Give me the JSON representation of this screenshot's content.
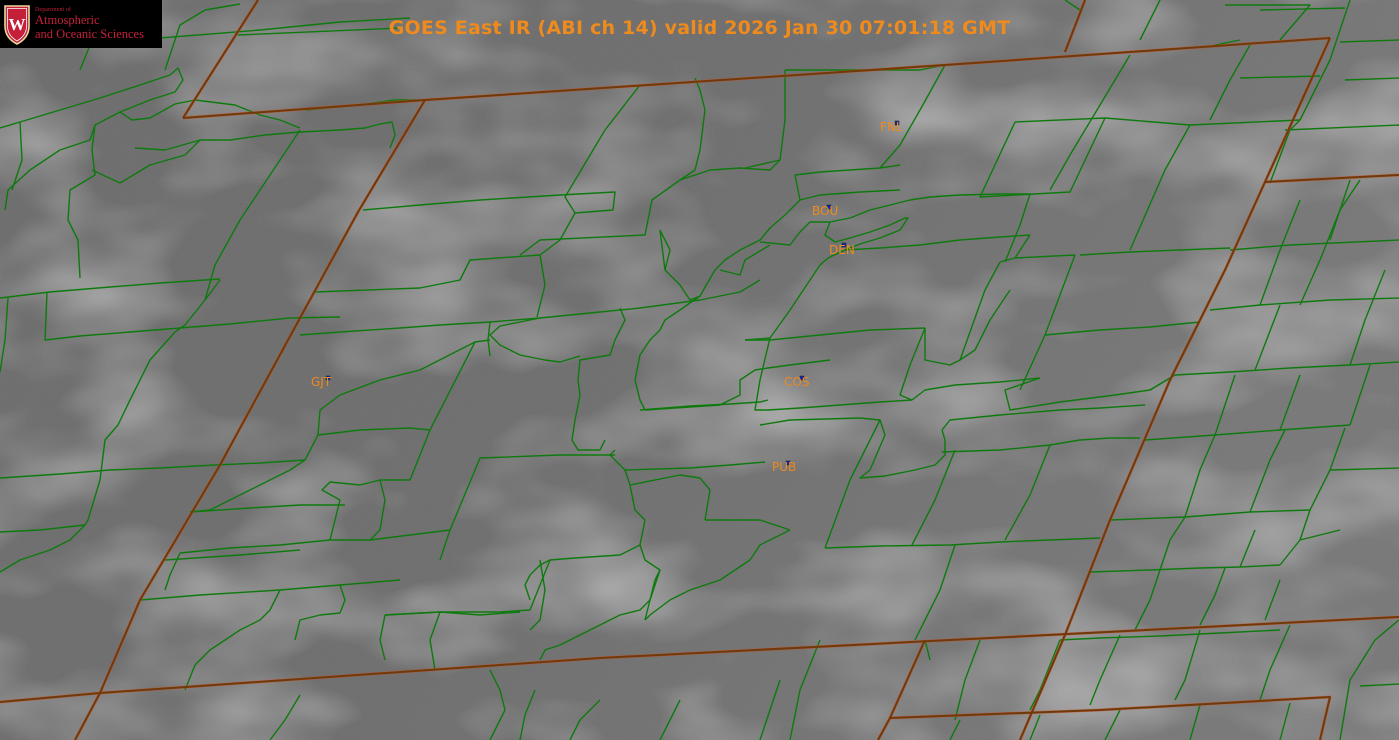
{
  "title": "GOES East IR (ABI ch 14) valid 2026 Jan 30 07:01:18 GMT",
  "logo": {
    "crest_letter": "W",
    "department_line": "Department of",
    "line1": "Atmospheric",
    "line2": "and Oceanic Sciences"
  },
  "stations": [
    {
      "id": "FNL"
    },
    {
      "id": "BOU"
    },
    {
      "id": "DEN"
    },
    {
      "id": "COS"
    },
    {
      "id": "PUB"
    },
    {
      "id": "GJT"
    }
  ],
  "colors": {
    "title_text": "#ef8a1c",
    "station_text": "#ef8a1c",
    "county_lines": "#0e7a0e",
    "state_lines": "#8a3a0e",
    "station_marker": "#1020c0",
    "logo_red": "#c5203a",
    "background_ir": "#6e6e6e"
  },
  "icons": {
    "logo": "uw-crest-icon",
    "station": "station-marker-icon"
  }
}
